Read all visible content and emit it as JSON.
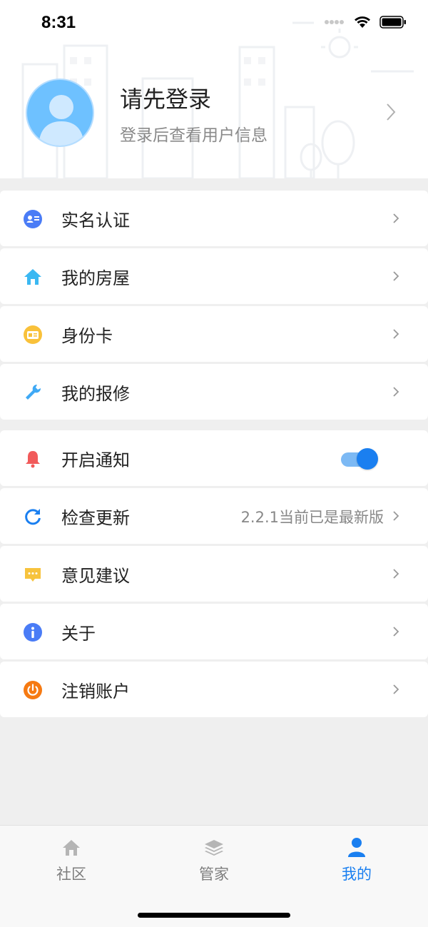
{
  "status_bar": {
    "time": "8:31"
  },
  "profile": {
    "title": "请先登录",
    "subtitle": "登录后查看用户信息"
  },
  "menu_group_1": [
    {
      "label": "实名认证",
      "icon": "id-badge-icon",
      "color": "#4a7cf6"
    },
    {
      "label": "我的房屋",
      "icon": "house-icon",
      "color": "#3bb8f2"
    },
    {
      "label": "身份卡",
      "icon": "id-card-icon",
      "color": "#f9c13a"
    },
    {
      "label": "我的报修",
      "icon": "wrench-icon",
      "color": "#3fa9f5"
    }
  ],
  "menu_group_2": [
    {
      "label": "开启通知",
      "icon": "bell-icon",
      "color": "#f15a5a",
      "toggle_on": true
    },
    {
      "label": "检查更新",
      "icon": "refresh-icon",
      "color": "#1a7ff0",
      "extra": "2.2.1当前已是最新版"
    },
    {
      "label": "意见建议",
      "icon": "chat-icon",
      "color": "#f7c33d"
    },
    {
      "label": "关于",
      "icon": "info-icon",
      "color": "#4a7cf6"
    },
    {
      "label": "注销账户",
      "icon": "power-icon",
      "color": "#f67a12"
    }
  ],
  "tabbar": {
    "tabs": [
      {
        "label": "社区",
        "icon": "home-icon",
        "active": false
      },
      {
        "label": "管家",
        "icon": "layers-icon",
        "active": false
      },
      {
        "label": "我的",
        "icon": "person-icon",
        "active": true
      }
    ],
    "active_color": "#1a7ff0"
  }
}
